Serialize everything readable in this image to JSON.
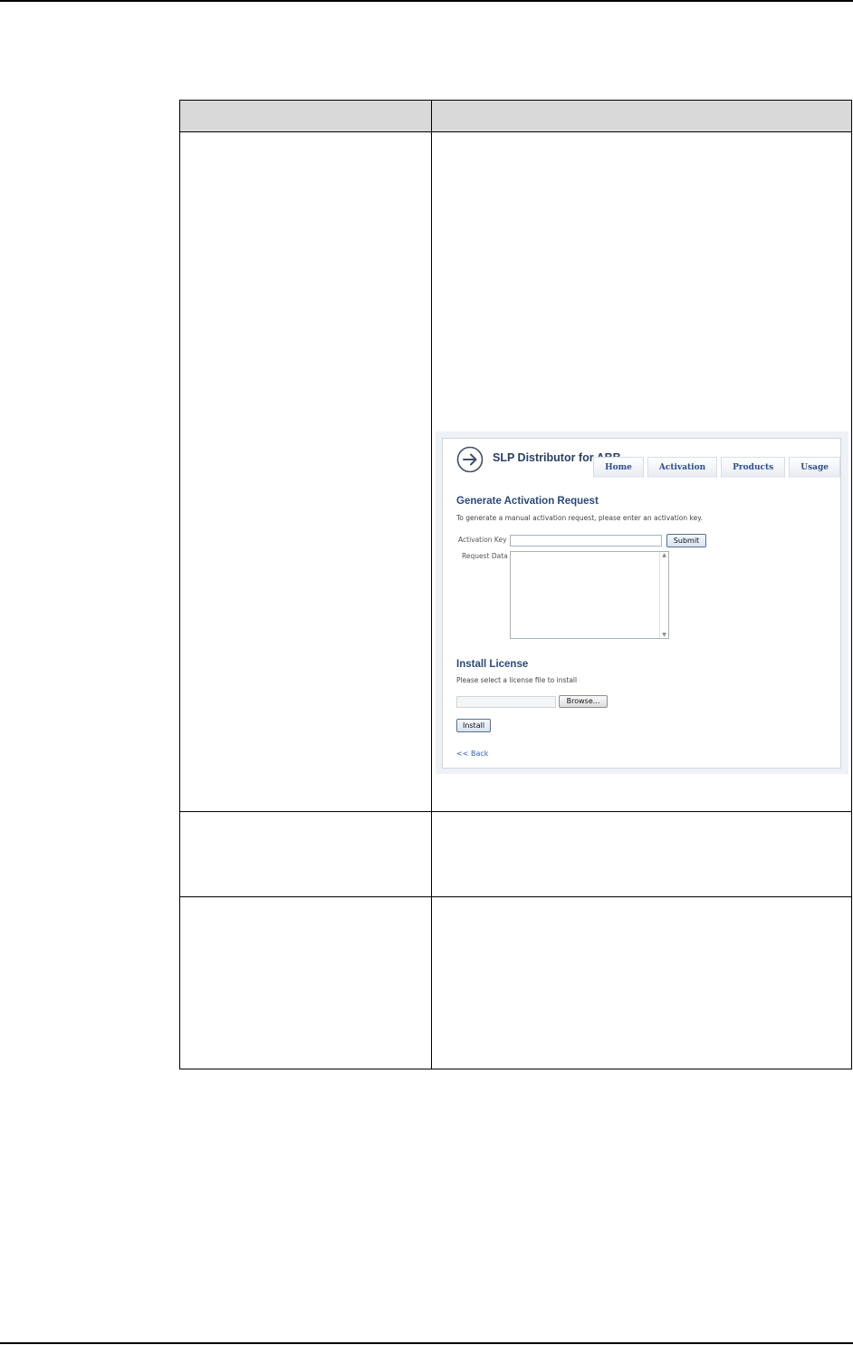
{
  "app": {
    "title": "SLP Distributor for ABB",
    "nav": [
      "Home",
      "Activation",
      "Products",
      "Usage"
    ]
  },
  "generate": {
    "heading": "Generate Activation Request",
    "instruction": "To generate a manual activation request, please enter an activation key.",
    "activation_key_label": "Activation Key",
    "request_data_label": "Request Data",
    "submit_label": "Submit"
  },
  "install": {
    "heading": "Install License",
    "instruction": "Please select a license file to install",
    "browse_label": "Browse...",
    "install_label": "Install"
  },
  "back_link": "<< Back"
}
